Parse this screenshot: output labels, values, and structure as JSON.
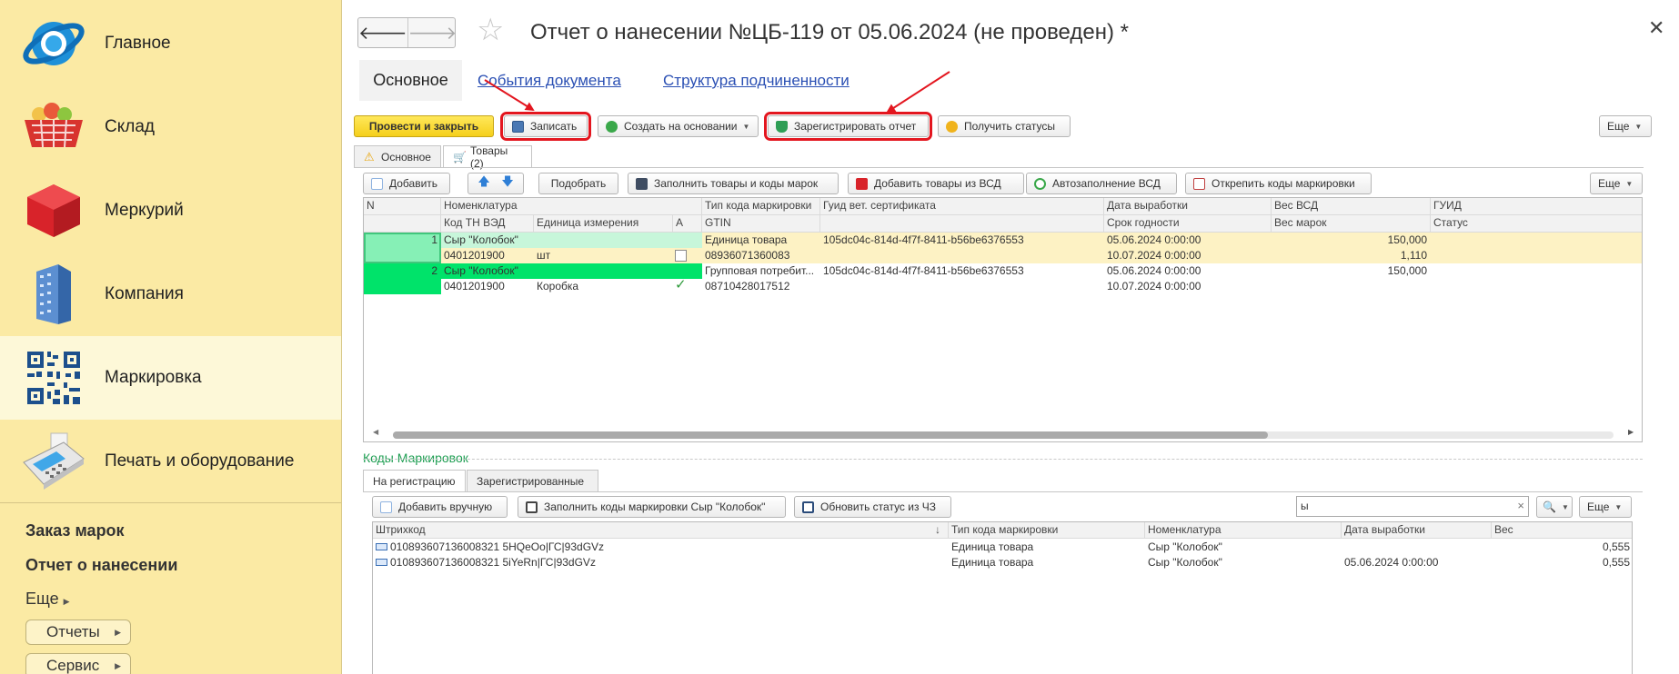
{
  "sidebar": {
    "items": [
      {
        "label": "Главное",
        "icon": "globe-icon"
      },
      {
        "label": "Склад",
        "icon": "basket-icon"
      },
      {
        "label": "Меркурий",
        "icon": "cube-icon"
      },
      {
        "label": "Компания",
        "icon": "building-icon"
      },
      {
        "label": "Маркировка",
        "icon": "qr-code-icon"
      },
      {
        "label": "Печать и оборудование",
        "icon": "card-terminal-icon"
      }
    ],
    "links": [
      "Заказ марок",
      "Отчет о нанесении",
      "Еще"
    ],
    "buttons": [
      "Отчеты",
      "Сервис"
    ]
  },
  "header": {
    "title": "Отчет о нанесении №ЦБ-119 от 05.06.2024 (не проведен) *",
    "tabs": [
      "Основное",
      "События документа",
      "Структура подчиненности"
    ]
  },
  "toolbar": {
    "post_close": "Провести и закрыть",
    "save": "Записать",
    "create_based": "Создать на основании",
    "register_report": "Зарегистрировать отчет",
    "get_statuses": "Получить статусы",
    "more": "Еще"
  },
  "inner_tabs": [
    "Основное",
    "Товары (2)"
  ],
  "goods_toolbar": {
    "add": "Добавить",
    "pick": "Подобрать",
    "fill_goods": "Заполнить товары и коды марок",
    "add_from_vsd": "Добавить товары из ВСД",
    "autofill_vsd": "Автозаполнение ВСД",
    "unpin_codes": "Открепить коды маркировки",
    "more": "Еще"
  },
  "goods_table": {
    "head1": [
      "N",
      "Номенклатура",
      "Тип кода маркировки",
      "Гуид вет. сертификата",
      "Дата выработки",
      "Вес ВСД",
      "ГУИД"
    ],
    "head2": [
      "Код ТН ВЭД",
      "Единица измерения",
      "А",
      "GTIN",
      "Срок годности",
      "Вес марок",
      "Статус"
    ],
    "rows": [
      {
        "n": "1",
        "name": "Сыр \"Колобок\"",
        "code_type": "Единица товара",
        "guid_vet": "105dc04c-814d-4f7f-8411-b56be6376553",
        "date_prod": "05.06.2024 0:00:00",
        "weight_vsd": "150,000",
        "tnved": "0401201900",
        "unit": "шт",
        "a": false,
        "gtin": "08936071360083",
        "expiry": "10.07.2024 0:00:00",
        "weight_marks": "1,110"
      },
      {
        "n": "2",
        "name": "Сыр \"Колобок\"",
        "code_type": "Групповая потребит...",
        "guid_vet": "105dc04c-814d-4f7f-8411-b56be6376553",
        "date_prod": "05.06.2024 0:00:00",
        "weight_vsd": "150,000",
        "tnved": "0401201900",
        "unit": "Коробка",
        "a": true,
        "gtin": "08710428017512",
        "expiry": "10.07.2024 0:00:00",
        "weight_marks": ""
      }
    ]
  },
  "codes": {
    "title": "Коды Маркировок",
    "tabs": [
      "На регистрацию",
      "Зарегистрированные"
    ],
    "toolbar": {
      "add_manual": "Добавить вручную",
      "fill_codes": "Заполнить коды маркировки Сыр \"Колобок\"",
      "refresh_status": "Обновить статус из ЧЗ",
      "search_value": "ы",
      "more": "Еще"
    },
    "head": [
      "Штрихкод",
      "Тип кода маркировки",
      "Номенклатура",
      "Дата выработки",
      "Вес"
    ],
    "rows": [
      {
        "barcode": "010893607136008321 5HQeOo|ГС|93dGVz",
        "type": "Единица товара",
        "name": "Сыр \"Колобок\"",
        "date": "",
        "weight": "0,555"
      },
      {
        "barcode": "010893607136008321 5iYeRn|ГС|93dGVz",
        "type": "Единица товара",
        "name": "Сыр \"Колобок\"",
        "date": "05.06.2024 0:00:00",
        "weight": "0,555"
      }
    ]
  },
  "colors": {
    "sidebar_bg": "#fbeaa4",
    "primary_button": "#f5cf1b",
    "highlight_red": "#e3161f",
    "row_selected": "#fdf2c4",
    "row_green": "#00e36a",
    "section_green": "#1e9e52"
  }
}
